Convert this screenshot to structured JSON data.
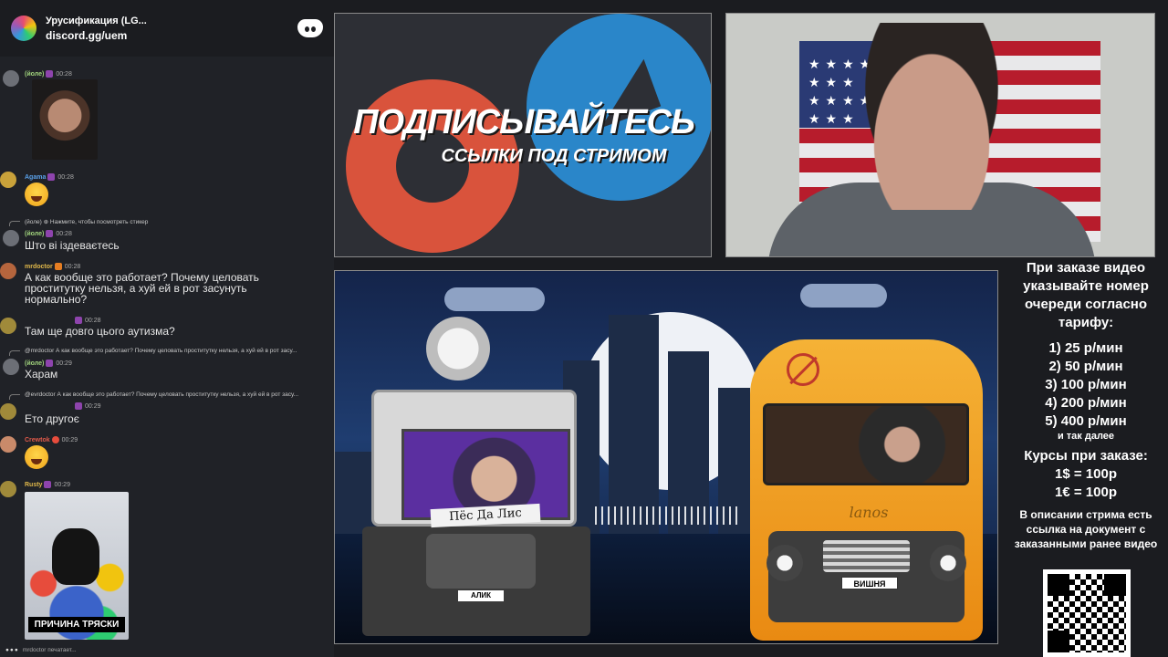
{
  "server": {
    "name": "Урусификация (LG...",
    "invite": "discord.gg/uem"
  },
  "chat": {
    "messages": [
      {
        "user": "(йоле)",
        "time": "00:28"
      },
      {
        "user": "Agama",
        "time": "00:28"
      },
      {
        "reply": "(йоле) ⊕ Нажмите, чтобы посмотреть стикер",
        "user": "(йоле)",
        "time": "00:28",
        "text": "Што ві іздеваєтесь"
      },
      {
        "user": "mrdoctor",
        "time": "00:28",
        "text": "А как вообще это работает? Почему целовать проститутку нельзя, а хуй ей в рот засунуть нормально?"
      },
      {
        "user": "",
        "time": "00:28",
        "text": "Там ще довго цього аутизма?"
      },
      {
        "reply": "@mrdoctor А как вообще это работает? Почему целовать проститутку нельзя, а хуй ей в рот засу...",
        "user": "(йоле)",
        "time": "00:29",
        "text": "Харам"
      },
      {
        "reply": "@evrdoctor А как вообще это работает? Почему целовать проститутку нельзя, а хуй ей в рот засу...",
        "user": "",
        "time": "00:29",
        "text": "Ето другоє"
      },
      {
        "user": "Crewtok",
        "time": "00:29"
      },
      {
        "user": "Rusty",
        "time": "00:29"
      }
    ],
    "cat_caption": "ПРИЧИНА ТРЯСКИ",
    "typing": "mrdoctor печатает..."
  },
  "banner": {
    "title": "ПОДПИСЫВАЙТЕСЬ",
    "subtitle": "ССЫЛКИ ПОД СТРИМОМ"
  },
  "scene": {
    "truck_sign": "Пёс Да Лис",
    "truck_plate": "АЛИК",
    "van_brand": "lanos",
    "van_plate": "ВИШНЯ"
  },
  "info": {
    "header": "При заказе видео указывайте номер очереди согласно тарифу:",
    "tiers": [
      "1) 25 р/мин",
      "2) 50 р/мин",
      "3) 100 р/мин",
      "4) 200 р/мин",
      "5) 400 р/мин"
    ],
    "etc": "и так далее",
    "rates_header": "Курсы при заказе:",
    "rates": [
      "1$ = 100р",
      "1€ = 100р"
    ],
    "desc": "В описании стрима есть ссылка на документ с заказанными ранее видео"
  },
  "colors": {
    "chat_bg": "#202227",
    "accent_orange": "#f5b236",
    "telegram_blue": "#2a86c9",
    "patreon_red": "#d9533c"
  }
}
